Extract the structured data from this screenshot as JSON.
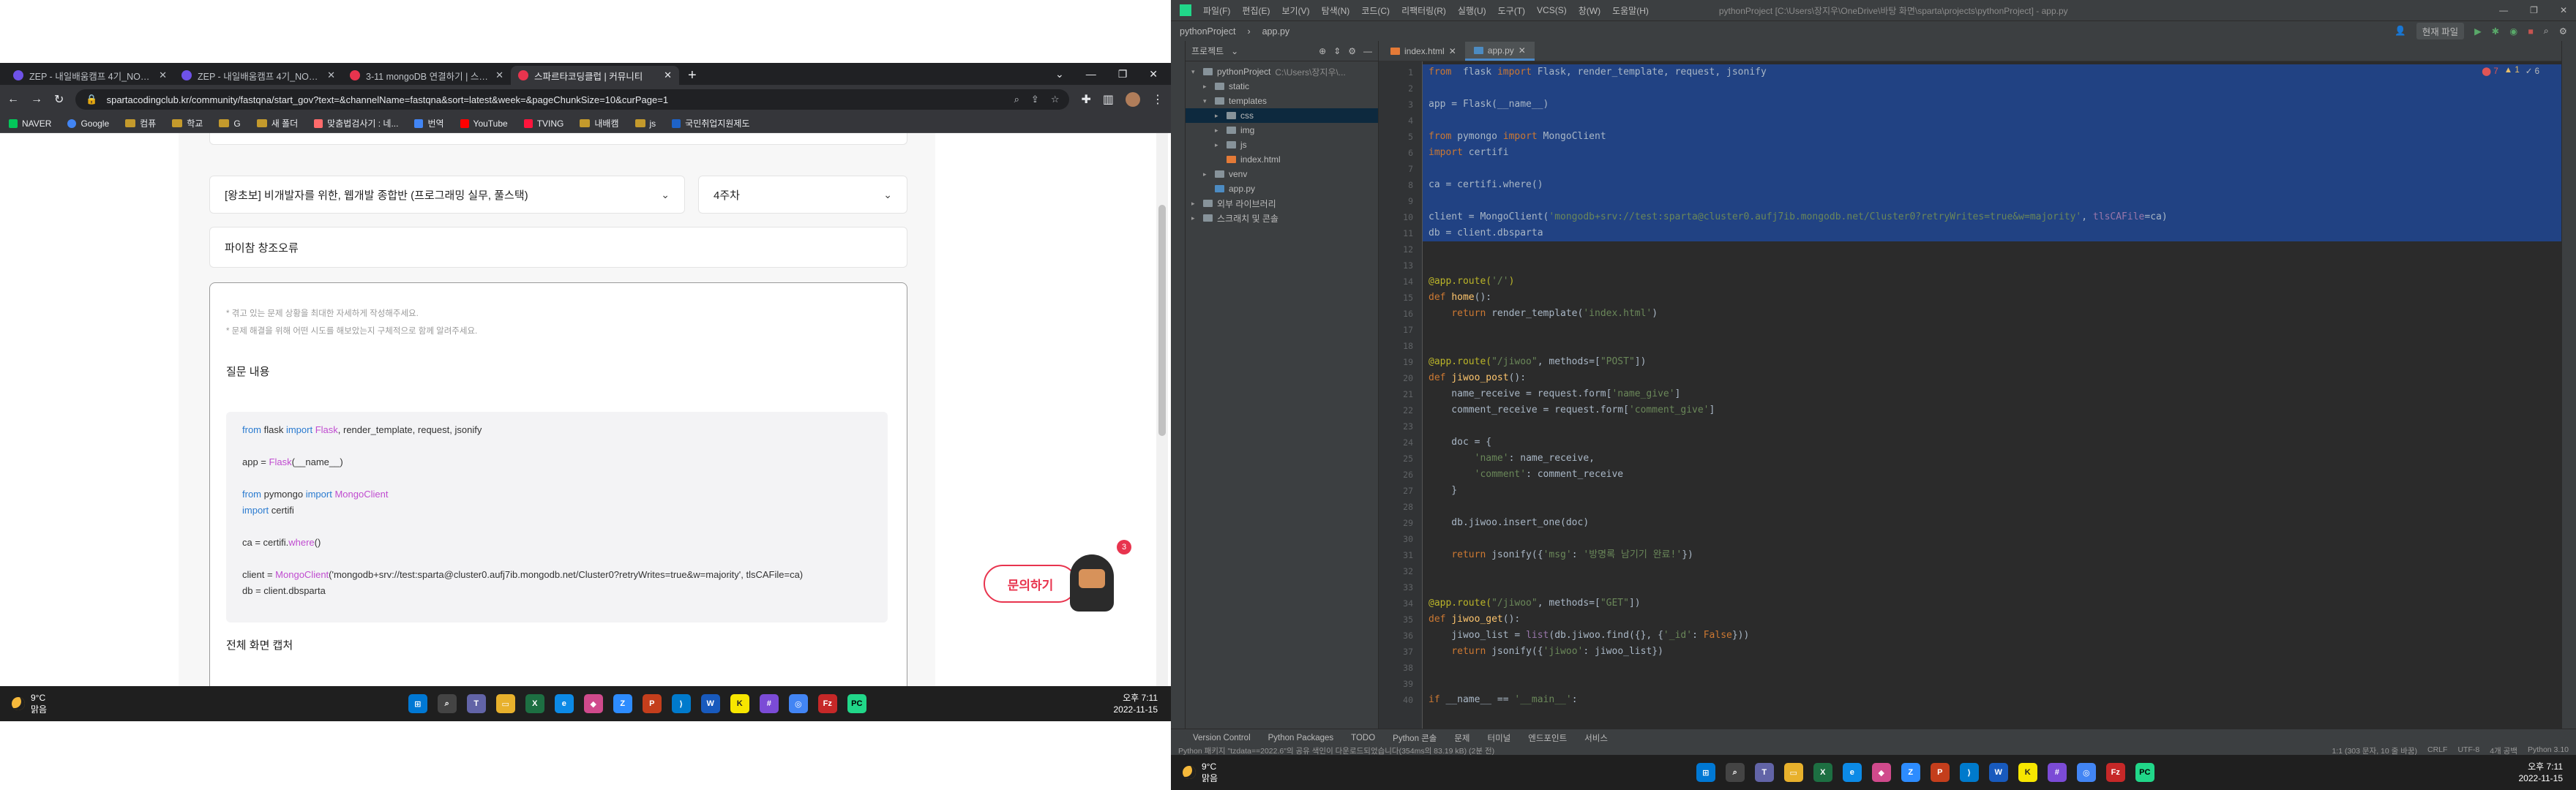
{
  "browser": {
    "tabs": [
      {
        "label": "ZEP - 내일배움캠프 4기_NODE...",
        "color": "#6e52e8"
      },
      {
        "label": "ZEP - 내일배움캠프 4기_NODE...",
        "color": "#6e52e8"
      },
      {
        "label": "3-11 mongoDB 연결하기 | 스파...",
        "color": "#e8344e"
      },
      {
        "label": "스파르타코딩클럽 | 커뮤니티",
        "color": "#e8344e"
      }
    ],
    "url": "spartacodingclub.kr/community/fastqna/start_gov?text=&channelName=fastqna&sort=latest&week=&pageChunkSize=10&curPage=1",
    "bookmarks": [
      "NAVER",
      "Google",
      "컴퓨",
      "학교",
      "G",
      "새 폴더",
      "맞춤법검사기 : 네...",
      "번역",
      "YouTube",
      "TVING",
      "내배캠",
      "js",
      "국민취업지원제도"
    ]
  },
  "page": {
    "course_select": "[왕초보] 비개발자를 위한, 웹개발 종합반 (프로그래밍 실무, 풀스택)",
    "week_select": "4주차",
    "title_input": "파이참 창조오류",
    "hints": [
      "* 겪고 있는 문제 상황을 최대한 자세하게 작성해주세요.",
      "* 문제 해결을 위해 어떤 시도를 해보았는지 구체적으로 함께 알려주세요."
    ],
    "question_label": "질문 내용",
    "code": {
      "l1a": "from",
      "l1b": " flask ",
      "l1c": "import",
      "l1d": " Flask",
      "l1e": ", render_template, request, jsonify",
      "l2a": "app = ",
      "l2b": "Flask",
      "l2c": "(__name__)",
      "l3a": "from",
      "l3b": " pymongo ",
      "l3c": "import",
      "l3d": " MongoClient",
      "l4a": "import",
      "l4b": " certifi",
      "l5a": "ca = certifi.",
      "l5b": "where",
      "l5c": "()",
      "l6a": "client = ",
      "l6b": "MongoClient",
      "l6c": "('mongodb+srv://test:sparta@cluster0.aufj7ib.mongodb.net/Cluster0?retryWrites=true&w=majority', tlsCAFile=ca)",
      "l7": "db = client.dbsparta"
    },
    "capture_label": "전체 화면 캡처",
    "ask_button": "문의하기",
    "notification_count": "3"
  },
  "taskbar_left": {
    "weather_temp": "9°C",
    "weather_desc": "맑음",
    "time": "오후 7:11",
    "date": "2022-11-15"
  },
  "taskbar_right": {
    "weather_temp": "9°C",
    "weather_desc": "맑음",
    "time": "오후 7:11",
    "date": "2022-11-15"
  },
  "ide": {
    "menu": [
      "파일(F)",
      "편집(E)",
      "보기(V)",
      "탐색(N)",
      "코드(C)",
      "리팩터링(R)",
      "실행(U)",
      "도구(T)",
      "VCS(S)",
      "창(W)",
      "도움말(H)"
    ],
    "window_title": "pythonProject [C:\\Users\\장지우\\OneDrive\\바탕 화면\\sparta\\projects\\pythonProject] - app.py",
    "breadcrumb_project": "pythonProject",
    "breadcrumb_file": "app.py",
    "run_config": "현재 파일",
    "project_header": "프로젝트",
    "tree": [
      {
        "label": "pythonProject",
        "extra": "C:\\Users\\장지우\\...",
        "depth": 0,
        "kind": "folder",
        "open": true
      },
      {
        "label": "static",
        "depth": 1,
        "kind": "folder"
      },
      {
        "label": "templates",
        "depth": 1,
        "kind": "folder",
        "open": true
      },
      {
        "label": "css",
        "depth": 2,
        "kind": "folder",
        "sel": true
      },
      {
        "label": "img",
        "depth": 2,
        "kind": "folder"
      },
      {
        "label": "js",
        "depth": 2,
        "kind": "folder"
      },
      {
        "label": "index.html",
        "depth": 2,
        "kind": "html"
      },
      {
        "label": "venv",
        "depth": 1,
        "kind": "folder"
      },
      {
        "label": "app.py",
        "depth": 1,
        "kind": "py"
      },
      {
        "label": "외부 라이브러리",
        "depth": 0,
        "kind": "folder"
      },
      {
        "label": "스크래치 및 콘솔",
        "depth": 0,
        "kind": "folder"
      }
    ],
    "editor_tabs": [
      "index.html",
      "app.py"
    ],
    "inspections": {
      "errors": "7",
      "warnings": "1",
      "weak": "6"
    },
    "bottom_tabs": [
      "Version Control",
      "Python Packages",
      "TODO",
      "Python 콘솔",
      "문제",
      "터미널",
      "엔드포인트",
      "서비스"
    ],
    "status_message": "Python 패키지 \"tzdata==2022.6\"의 공유 색인이 다운로드되었습니다(354ms의 83.19 kB) (2분 전)",
    "status_right": [
      "1:1 (303 문자, 10 줄 바꿈)",
      "CRLF",
      "UTF-8",
      "4개 공백",
      "Python 3.10"
    ]
  },
  "code_lines": [
    {
      "n": "1",
      "sel": true,
      "t": [
        [
          "k",
          "from"
        ],
        [
          "",
          "  flask "
        ],
        [
          "k",
          "import"
        ],
        [
          "",
          " Flask, render_template, request, jsonify"
        ]
      ]
    },
    {
      "n": "2",
      "sel": true,
      "t": [
        [
          "",
          ""
        ]
      ]
    },
    {
      "n": "3",
      "sel": true,
      "t": [
        [
          "",
          "app = Flask(__name__)"
        ]
      ]
    },
    {
      "n": "4",
      "sel": true,
      "t": [
        [
          "",
          ""
        ]
      ]
    },
    {
      "n": "5",
      "sel": true,
      "t": [
        [
          "k",
          "from"
        ],
        [
          "",
          " pymongo "
        ],
        [
          "k",
          "import"
        ],
        [
          "",
          " MongoClient"
        ]
      ]
    },
    {
      "n": "6",
      "sel": true,
      "t": [
        [
          "k",
          "import"
        ],
        [
          "",
          " certifi"
        ]
      ]
    },
    {
      "n": "7",
      "sel": true,
      "t": [
        [
          "",
          ""
        ]
      ]
    },
    {
      "n": "8",
      "sel": true,
      "t": [
        [
          "",
          "ca = certifi.where()"
        ]
      ]
    },
    {
      "n": "9",
      "sel": true,
      "t": [
        [
          "",
          ""
        ]
      ]
    },
    {
      "n": "10",
      "sel": true,
      "t": [
        [
          "",
          "client = MongoClient("
        ],
        [
          "s",
          "'mongodb+srv://test:sparta@cluster0.aufj7ib.mongodb.net/Cluster0?retryWrites=true&w=majority'"
        ],
        [
          "",
          ", "
        ],
        [
          "p",
          "tlsCAFile"
        ],
        [
          "",
          "=ca)"
        ]
      ]
    },
    {
      "n": "11",
      "sel": true,
      "t": [
        [
          "",
          "db = client.dbsparta"
        ]
      ]
    },
    {
      "n": "12",
      "t": [
        [
          "",
          ""
        ]
      ]
    },
    {
      "n": "13",
      "t": [
        [
          "",
          ""
        ]
      ]
    },
    {
      "n": "14",
      "t": [
        [
          "d",
          "@app.route("
        ],
        [
          "s",
          "'/'"
        ],
        [
          "d",
          ")"
        ]
      ]
    },
    {
      "n": "15",
      "t": [
        [
          "k",
          "def "
        ],
        [
          "f",
          "home"
        ],
        [
          "",
          "():"
        ]
      ]
    },
    {
      "n": "16",
      "t": [
        [
          "",
          "    "
        ],
        [
          "k",
          "return"
        ],
        [
          "",
          " render_template("
        ],
        [
          "s",
          "'index.html'"
        ],
        [
          "",
          ")"
        ]
      ]
    },
    {
      "n": "17",
      "t": [
        [
          "",
          ""
        ]
      ]
    },
    {
      "n": "18",
      "t": [
        [
          "",
          ""
        ]
      ]
    },
    {
      "n": "19",
      "t": [
        [
          "d",
          "@app.route("
        ],
        [
          "s",
          "\"/jiwoo\""
        ],
        [
          "",
          ", methods=["
        ],
        [
          "s",
          "\"POST\""
        ],
        [
          "",
          "])"
        ]
      ]
    },
    {
      "n": "20",
      "t": [
        [
          "k",
          "def "
        ],
        [
          "f",
          "jiwoo_post"
        ],
        [
          "",
          "():"
        ]
      ]
    },
    {
      "n": "21",
      "t": [
        [
          "",
          "    name_receive = request.form["
        ],
        [
          "s",
          "'name_give'"
        ],
        [
          "",
          "]"
        ]
      ]
    },
    {
      "n": "22",
      "t": [
        [
          "",
          "    comment_receive = request.form["
        ],
        [
          "s",
          "'comment_give'"
        ],
        [
          "",
          "]"
        ]
      ]
    },
    {
      "n": "23",
      "t": [
        [
          "",
          ""
        ]
      ]
    },
    {
      "n": "24",
      "t": [
        [
          "",
          "    doc = {"
        ]
      ]
    },
    {
      "n": "25",
      "t": [
        [
          "",
          "        "
        ],
        [
          "s",
          "'name'"
        ],
        [
          "",
          ": name_receive,"
        ]
      ]
    },
    {
      "n": "26",
      "t": [
        [
          "",
          "        "
        ],
        [
          "s",
          "'comment'"
        ],
        [
          "",
          ": comment_receive"
        ]
      ]
    },
    {
      "n": "27",
      "t": [
        [
          "",
          "    }"
        ]
      ]
    },
    {
      "n": "28",
      "t": [
        [
          "",
          ""
        ]
      ]
    },
    {
      "n": "29",
      "t": [
        [
          "",
          "    db.jiwoo.insert_one(doc)"
        ]
      ]
    },
    {
      "n": "30",
      "t": [
        [
          "",
          ""
        ]
      ]
    },
    {
      "n": "31",
      "t": [
        [
          "",
          "    "
        ],
        [
          "k",
          "return"
        ],
        [
          "",
          " jsonify({"
        ],
        [
          "s",
          "'msg'"
        ],
        [
          "",
          ": "
        ],
        [
          "s",
          "'방명록 남기기 완료!'"
        ],
        [
          "",
          "})"
        ]
      ]
    },
    {
      "n": "32",
      "t": [
        [
          "",
          ""
        ]
      ]
    },
    {
      "n": "33",
      "t": [
        [
          "",
          ""
        ]
      ]
    },
    {
      "n": "34",
      "t": [
        [
          "d",
          "@app.route("
        ],
        [
          "s",
          "\"/jiwoo\""
        ],
        [
          "",
          ", methods=["
        ],
        [
          "s",
          "\"GET\""
        ],
        [
          "",
          "])"
        ]
      ]
    },
    {
      "n": "35",
      "t": [
        [
          "k",
          "def "
        ],
        [
          "f",
          "jiwoo_get"
        ],
        [
          "",
          "():"
        ]
      ]
    },
    {
      "n": "36",
      "t": [
        [
          "",
          "    jiwoo_list = "
        ],
        [
          "p",
          "list"
        ],
        [
          "",
          "(db.jiwoo.find({}, {"
        ],
        [
          "s",
          "'_id'"
        ],
        [
          "",
          ": "
        ],
        [
          "k",
          "False"
        ],
        [
          "",
          "}))"
        ]
      ]
    },
    {
      "n": "37",
      "t": [
        [
          "",
          "    "
        ],
        [
          "k",
          "return"
        ],
        [
          "",
          " jsonify({"
        ],
        [
          "s",
          "'jiwoo'"
        ],
        [
          "",
          ": jiwoo_list})"
        ]
      ]
    },
    {
      "n": "38",
      "t": [
        [
          "",
          ""
        ]
      ]
    },
    {
      "n": "39",
      "t": [
        [
          "",
          ""
        ]
      ]
    },
    {
      "n": "40",
      "t": [
        [
          "k",
          "if"
        ],
        [
          "",
          " __name__ == "
        ],
        [
          "s",
          "'__main__'"
        ],
        [
          "",
          ":"
        ]
      ]
    }
  ]
}
